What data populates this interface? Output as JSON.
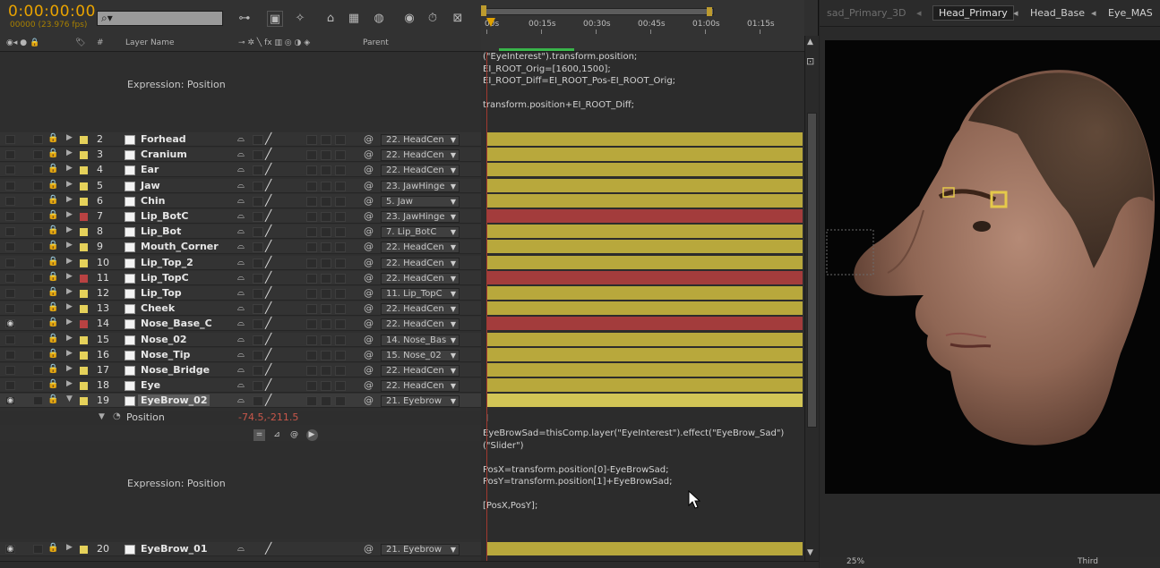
{
  "timeline": {
    "timecode": "0:00:00:00",
    "frame_info": "00000 (23.976 fps)",
    "search_placeholder": "",
    "columns": {
      "number": "#",
      "layer_name": "Layer Name",
      "parent": "Parent"
    },
    "expression_label": "Expression: Position",
    "layers": [
      {
        "num": "2",
        "name": "Forhead",
        "label": "#e5d15a",
        "parent": "22. HeadCen",
        "bar": "#b8a83c",
        "eye": false
      },
      {
        "num": "3",
        "name": "Cranium",
        "label": "#e5d15a",
        "parent": "22. HeadCen",
        "bar": "#b8a83c",
        "eye": false
      },
      {
        "num": "4",
        "name": "Ear",
        "label": "#e5d15a",
        "parent": "22. HeadCen",
        "bar": "#b8a83c",
        "eye": false
      },
      {
        "num": "5",
        "name": "Jaw",
        "label": "#e5d15a",
        "parent": "23. JawHinge",
        "bar": "#b8a83c",
        "eye": false
      },
      {
        "num": "6",
        "name": "Chin",
        "label": "#e5d15a",
        "parent": "5. Jaw",
        "bar": "#b8a83c",
        "eye": false
      },
      {
        "num": "7",
        "name": "Lip_BotC",
        "label": "#b94242",
        "parent": "23. JawHinge",
        "bar": "#a33c3c",
        "eye": false
      },
      {
        "num": "8",
        "name": "Lip_Bot",
        "label": "#e5d15a",
        "parent": "7. Lip_BotC",
        "bar": "#b8a83c",
        "eye": false
      },
      {
        "num": "9",
        "name": "Mouth_Corner",
        "label": "#e5d15a",
        "parent": "22. HeadCen",
        "bar": "#b8a83c",
        "eye": false
      },
      {
        "num": "10",
        "name": "Lip_Top_2",
        "label": "#e5d15a",
        "parent": "22. HeadCen",
        "bar": "#b8a83c",
        "eye": false
      },
      {
        "num": "11",
        "name": "Lip_TopC",
        "label": "#b94242",
        "parent": "22. HeadCen",
        "bar": "#a33c3c",
        "eye": false
      },
      {
        "num": "12",
        "name": "Lip_Top",
        "label": "#e5d15a",
        "parent": "11. Lip_TopC",
        "bar": "#b8a83c",
        "eye": false
      },
      {
        "num": "13",
        "name": "Cheek",
        "label": "#e5d15a",
        "parent": "22. HeadCen",
        "bar": "#b8a83c",
        "eye": false
      },
      {
        "num": "14",
        "name": "Nose_Base_C",
        "label": "#b94242",
        "parent": "22. HeadCen",
        "bar": "#a33c3c",
        "eye": true
      },
      {
        "num": "15",
        "name": "Nose_02",
        "label": "#e5d15a",
        "parent": "14. Nose_Bas",
        "bar": "#b8a83c",
        "eye": false
      },
      {
        "num": "16",
        "name": "Nose_Tip",
        "label": "#e5d15a",
        "parent": "15. Nose_02",
        "bar": "#b8a83c",
        "eye": false
      },
      {
        "num": "17",
        "name": "Nose_Bridge",
        "label": "#e5d15a",
        "parent": "22. HeadCen",
        "bar": "#b8a83c",
        "eye": false
      },
      {
        "num": "18",
        "name": "Eye",
        "label": "#e5d15a",
        "parent": "22. HeadCen",
        "bar": "#b8a83c",
        "eye": false
      },
      {
        "num": "19",
        "name": "EyeBrow_02",
        "label": "#e5d15a",
        "parent": "21. Eyebrow",
        "bar": "#d2c556",
        "eye": true,
        "selected": true
      }
    ],
    "layer_20": {
      "num": "20",
      "name": "EyeBrow_01",
      "label": "#e5d15a",
      "parent": "21. Eyebrow",
      "bar": "#b8a83c",
      "eye": true
    },
    "position_row": {
      "label": "Position",
      "value": "-74.5,-211.5"
    },
    "ruler_ticks": [
      "00s",
      "00:15s",
      "00:30s",
      "00:45s",
      "01:00s",
      "01:15s"
    ],
    "expression_top": "(\"EyeInterest\").transform.position;\nEI_ROOT_Orig=[1600,1500];\nEI_ROOT_Diff=EI_ROOT_Pos-EI_ROOT_Orig;\n\ntransform.position+EI_ROOT_Diff;",
    "expression_bottom": "EyeBrowSad=thisComp.layer(\"EyeInterest\").effect(\"EyeBrow_Sad\")\n(\"Slider\")\n\nPosX=transform.position[0]-EyeBrowSad;\nPosY=transform.position[1]+EyeBrowSad;\n\n[PosX,PosY];",
    "text_cursor": "I"
  },
  "viewer": {
    "tabs": [
      {
        "label": "sad_Primary_3D",
        "active": false
      },
      {
        "label": "Head_Primary",
        "active": true
      },
      {
        "label": "Head_Base",
        "active": false
      },
      {
        "label": "Eye_MAS",
        "active": false
      }
    ],
    "zoom": "25%",
    "camera": "Third"
  },
  "colors": {
    "timecode": "#e9a300",
    "cti": "#e0a100",
    "bar_yellow": "#b8a83c",
    "bar_red": "#a33c3c"
  }
}
